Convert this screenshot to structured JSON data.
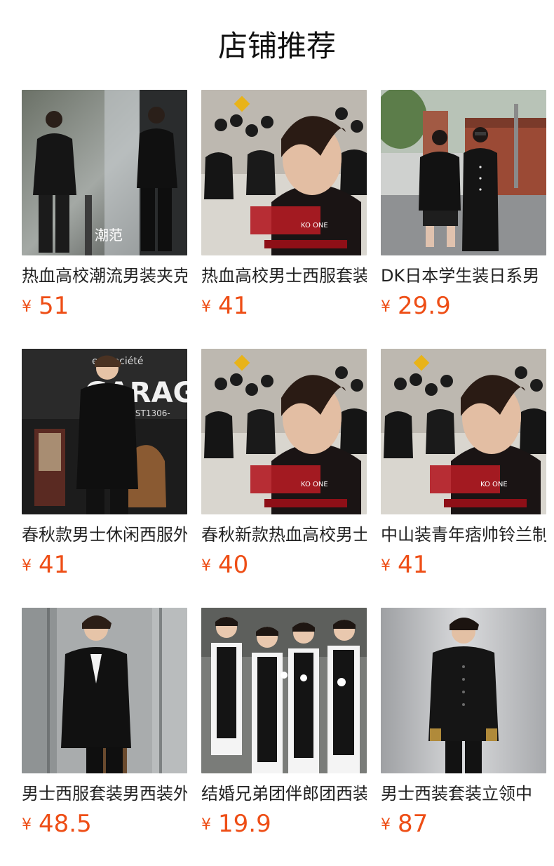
{
  "section": {
    "title": "店铺推荐"
  },
  "products": [
    {
      "name": "热血高校潮流男装夹克",
      "currency": "¥",
      "price": "51",
      "image": "two-men-dark-jackets-street"
    },
    {
      "name": "热血高校男士西服套装",
      "currency": "¥",
      "price": "41",
      "image": "ko-one-poster"
    },
    {
      "name": "DK日本学生装日系男",
      "currency": "¥",
      "price": "29.9",
      "image": "students-uniform-street"
    },
    {
      "name": "春秋款男士休闲西服外套",
      "currency": "¥",
      "price": "41",
      "image": "man-black-suit-garage"
    },
    {
      "name": "春秋新款热血高校男士",
      "currency": "¥",
      "price": "40",
      "image": "ko-one-poster"
    },
    {
      "name": "中山装青年痞帅铃兰制服",
      "currency": "¥",
      "price": "41",
      "image": "ko-one-poster"
    },
    {
      "name": "男士西服套装男西装外套",
      "currency": "¥",
      "price": "48.5",
      "image": "man-black-blazer"
    },
    {
      "name": "结婚兄弟团伴郎团西装",
      "currency": "¥",
      "price": "19.9",
      "image": "groomsmen-vests"
    },
    {
      "name": "男士西装套装立领中",
      "currency": "¥",
      "price": "87",
      "image": "man-chinese-suit"
    }
  ]
}
